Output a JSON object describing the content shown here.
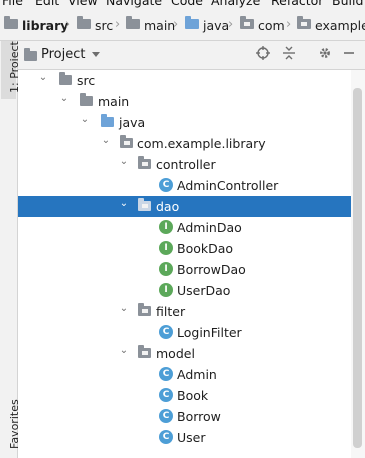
{
  "menu": [
    "File",
    "Edit",
    "View",
    "Navigate",
    "Code",
    "Analyze",
    "Refactor",
    "Build"
  ],
  "breadcrumb": [
    "library",
    "src",
    "main",
    "java",
    "com",
    "example"
  ],
  "stripe": {
    "project_tab": "1: Project",
    "favorites_tab": "Favorites"
  },
  "toolbar": {
    "title": "Project",
    "dropdown_icon": "chevron-down-icon",
    "icons": [
      "target-icon",
      "collapse-icon",
      "gear-icon",
      "minimize-icon"
    ]
  },
  "tree": [
    {
      "label": "src",
      "kind": "folder",
      "expanded": true
    },
    {
      "label": "main",
      "kind": "folder",
      "expanded": true
    },
    {
      "label": "java",
      "kind": "source-folder",
      "expanded": true
    },
    {
      "label": "com.example.library",
      "kind": "package",
      "expanded": true
    },
    {
      "label": "controller",
      "kind": "package",
      "expanded": true
    },
    {
      "label": "AdminController",
      "kind": "class"
    },
    {
      "label": "dao",
      "kind": "package",
      "expanded": true,
      "selected": true
    },
    {
      "label": "AdminDao",
      "kind": "interface"
    },
    {
      "label": "BookDao",
      "kind": "interface"
    },
    {
      "label": "BorrowDao",
      "kind": "interface"
    },
    {
      "label": "UserDao",
      "kind": "interface"
    },
    {
      "label": "filter",
      "kind": "package",
      "expanded": true
    },
    {
      "label": "LoginFilter",
      "kind": "class"
    },
    {
      "label": "model",
      "kind": "package",
      "expanded": true
    },
    {
      "label": "Admin",
      "kind": "class"
    },
    {
      "label": "Book",
      "kind": "class"
    },
    {
      "label": "Borrow",
      "kind": "class"
    },
    {
      "label": "User",
      "kind": "class"
    }
  ],
  "colors": {
    "selection": "#2675bf",
    "class_icon": "#4d9ed6",
    "interface_icon": "#5ca85a",
    "source_folder": "#6ea3d8"
  }
}
